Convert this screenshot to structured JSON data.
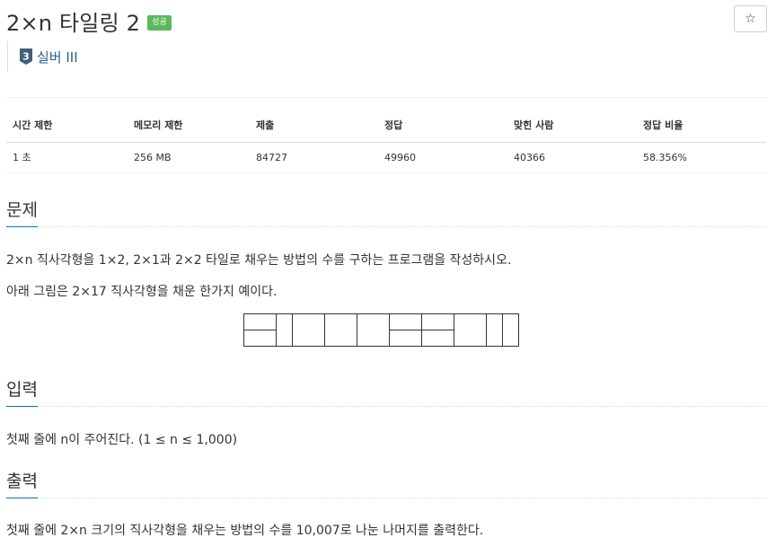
{
  "problem": {
    "title": "2×n 타일링 2",
    "status_badge": "성공",
    "star_icon": "☆",
    "tier": {
      "number": "3",
      "label": "실버 III",
      "icon": "silver-tier-icon",
      "color": "#435f7a"
    }
  },
  "stats": {
    "headers": [
      "시간 제한",
      "메모리 제한",
      "제출",
      "정답",
      "맞힌 사람",
      "정답 비율"
    ],
    "values": [
      "1 초",
      "256 MB",
      "84727",
      "49960",
      "40366",
      "58.356%"
    ]
  },
  "sections": {
    "problem": {
      "title": "문제",
      "p1": "2×n 직사각형을 1×2, 2×1과 2×2 타일로 채우는 방법의 수를 구하는 프로그램을 작성하시오.",
      "p2": "아래 그림은 2×17 직사각형을 채운 한가지 예이다."
    },
    "input": {
      "title": "입력",
      "p1": "첫째 줄에 n이 주어진다. (1 ≤ n ≤ 1,000)"
    },
    "output": {
      "title": "출력",
      "p1": "첫째 줄에 2×n 크기의 직사각형을 채우는 방법의 수를 10,007로 나눈 나머지를 출력한다."
    }
  },
  "colors": {
    "success": "#5cb85c",
    "link": "#2c5f8a",
    "accent_underline": "#0076c0"
  }
}
